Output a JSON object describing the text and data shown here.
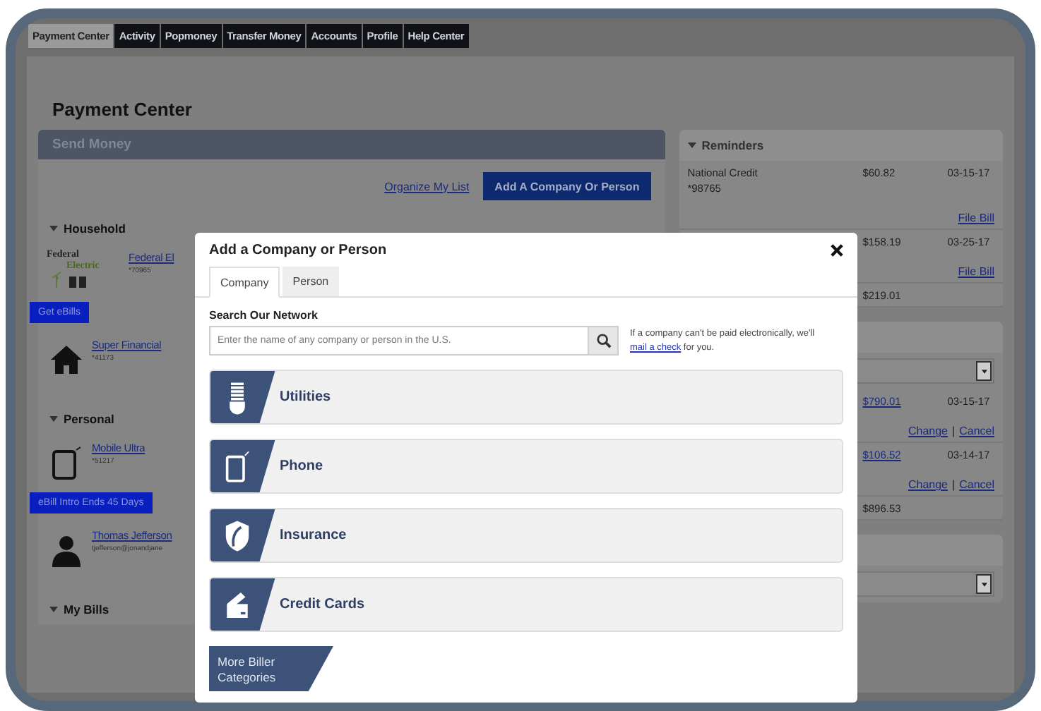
{
  "tabs": [
    {
      "label": "Payment Center",
      "selected": true
    },
    {
      "label": "Activity",
      "selected": false
    },
    {
      "label": "Popmoney",
      "selected": false
    },
    {
      "label": "Transfer Money",
      "selected": false
    },
    {
      "label": "Accounts",
      "selected": false
    },
    {
      "label": "Profile",
      "selected": false
    },
    {
      "label": "Help Center",
      "selected": false
    }
  ],
  "page_title": "Payment Center",
  "send_money": {
    "title": "Send Money",
    "organize_link": "Organize My List",
    "add_button": "Add A Company Or Person",
    "groups": [
      {
        "name": "Household",
        "payees": [
          {
            "kind": "logo",
            "logo": [
              "Federal",
              "Electric"
            ],
            "name": "Federal El",
            "account": "*70965",
            "badge": "Get eBills"
          },
          {
            "kind": "house",
            "name": "Super Financial",
            "account": "*41173"
          }
        ]
      },
      {
        "name": "Personal",
        "payees": [
          {
            "kind": "tablet",
            "name": "Mobile Ultra",
            "account": "*51217",
            "badge": "eBill Intro Ends 45 Days"
          },
          {
            "kind": "person",
            "name": "Thomas Jefferson",
            "account": "tjefferson@jonandjane"
          }
        ]
      },
      {
        "name": "My Bills"
      }
    ]
  },
  "reminders": {
    "title": "Reminders",
    "rows": [
      {
        "name": "National Credit",
        "account": "*98765",
        "amount": "$60.82",
        "date": "03-15-17",
        "action": "File Bill"
      },
      {
        "amount": "$158.19",
        "date": "03-25-17",
        "action": "File Bill"
      },
      {
        "amount": "$219.01"
      }
    ]
  },
  "scheduled": {
    "rows": [
      {
        "amount": "$790.01",
        "amount_link": true,
        "date": "03-15-17",
        "actions": [
          "Change",
          "Cancel"
        ],
        "separator": "|"
      },
      {
        "amount": "$106.52",
        "amount_link": true,
        "date": "03-14-17",
        "actions": [
          "Change",
          "Cancel"
        ],
        "separator": "|"
      },
      {
        "amount": "$896.53",
        "amount_link": false
      }
    ]
  },
  "modal": {
    "title": "Add a Company or Person",
    "tabs": [
      {
        "label": "Company",
        "selected": true
      },
      {
        "label": "Person",
        "selected": false
      }
    ],
    "search_label": "Search Our Network",
    "search": {
      "placeholder": "Enter the name of any company or person in the U.S."
    },
    "note_before": "If a company can't be paid electronically, we'll",
    "note_link": "mail a check",
    "note_after": "for you.",
    "categories": [
      {
        "kind": "bulb",
        "label": "Utilities"
      },
      {
        "kind": "tablet",
        "label": "Phone"
      },
      {
        "kind": "shield",
        "label": "Insurance"
      },
      {
        "kind": "card",
        "label": "Credit Cards"
      }
    ],
    "more": "More Biller Categories"
  }
}
